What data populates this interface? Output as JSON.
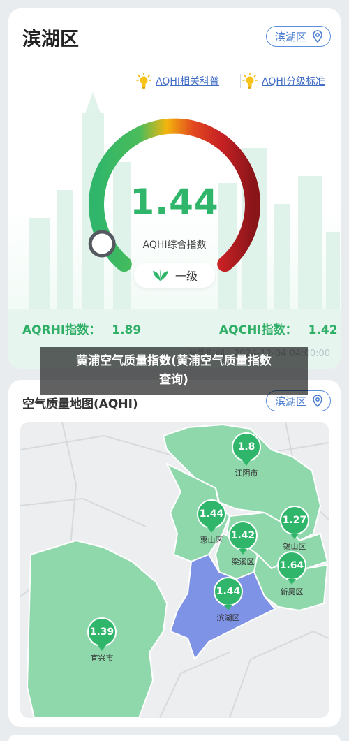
{
  "header": {
    "title": "滨湖区",
    "location_button": "滨湖区"
  },
  "tips": {
    "science_link": "AQHI相关科普",
    "standard_link": "AQHI分级标准"
  },
  "gauge": {
    "value": "1.44",
    "label": "AQHI综合指数",
    "level": "一级",
    "level_fraction": 0.1
  },
  "sub_indices": {
    "aqrhi_label": "AQRHI指数：",
    "aqrhi_value": "1.89",
    "aqchi_label": "AQCHI指数：",
    "aqchi_value": "1.42"
  },
  "update_time": "更新时间：2024-12-04 04:00:00",
  "overlay": {
    "line1": "黄浦空气质量指数(黄浦空气质量指数",
    "line2": "查询)"
  },
  "map": {
    "title": "空气质量地图(AQHI)",
    "location_button": "滨湖区",
    "markers": [
      {
        "name": "江阴市",
        "value": "1.8"
      },
      {
        "name": "惠山区",
        "value": "1.44"
      },
      {
        "name": "锡山区",
        "value": "1.27"
      },
      {
        "name": "梁溪区",
        "value": "1.42"
      },
      {
        "name": "新吴区",
        "value": "1.64"
      },
      {
        "name": "滨湖区",
        "value": "1.44"
      },
      {
        "name": "宜兴市",
        "value": "1.39"
      }
    ]
  },
  "colors": {
    "good_green": "#2fb66a",
    "link_blue": "#3f6dc4",
    "selected_district": "#7f93e6",
    "district_fill": "#8fd8ac"
  }
}
